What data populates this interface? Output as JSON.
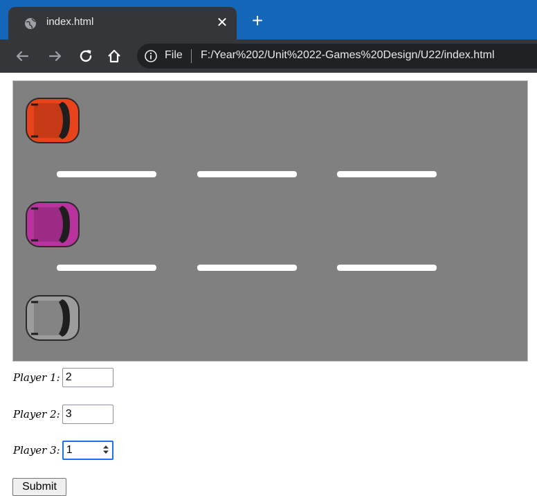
{
  "browser": {
    "tab_title": "index.html",
    "tab_close": "✕",
    "new_tab": "+",
    "site_chip": "File",
    "url": "F:/Year%202/Unit%2022-Games%20Design/U22/index.html",
    "colors": {
      "tab_strip": "#1466b8",
      "toolbar": "#35363a",
      "omnibox": "#202124"
    }
  },
  "game": {
    "background_color": "#808080",
    "lane_line_color": "#ffffff",
    "cars": [
      {
        "color": "#e8431a"
      },
      {
        "color": "#b8339e"
      },
      {
        "color": "#9c9c9c"
      }
    ]
  },
  "form": {
    "players": [
      {
        "label": "Player 1:",
        "value": "2"
      },
      {
        "label": "Player 2:",
        "value": "3"
      },
      {
        "label": "Player 3:",
        "value": "1"
      }
    ],
    "submit_label": "Submit"
  }
}
